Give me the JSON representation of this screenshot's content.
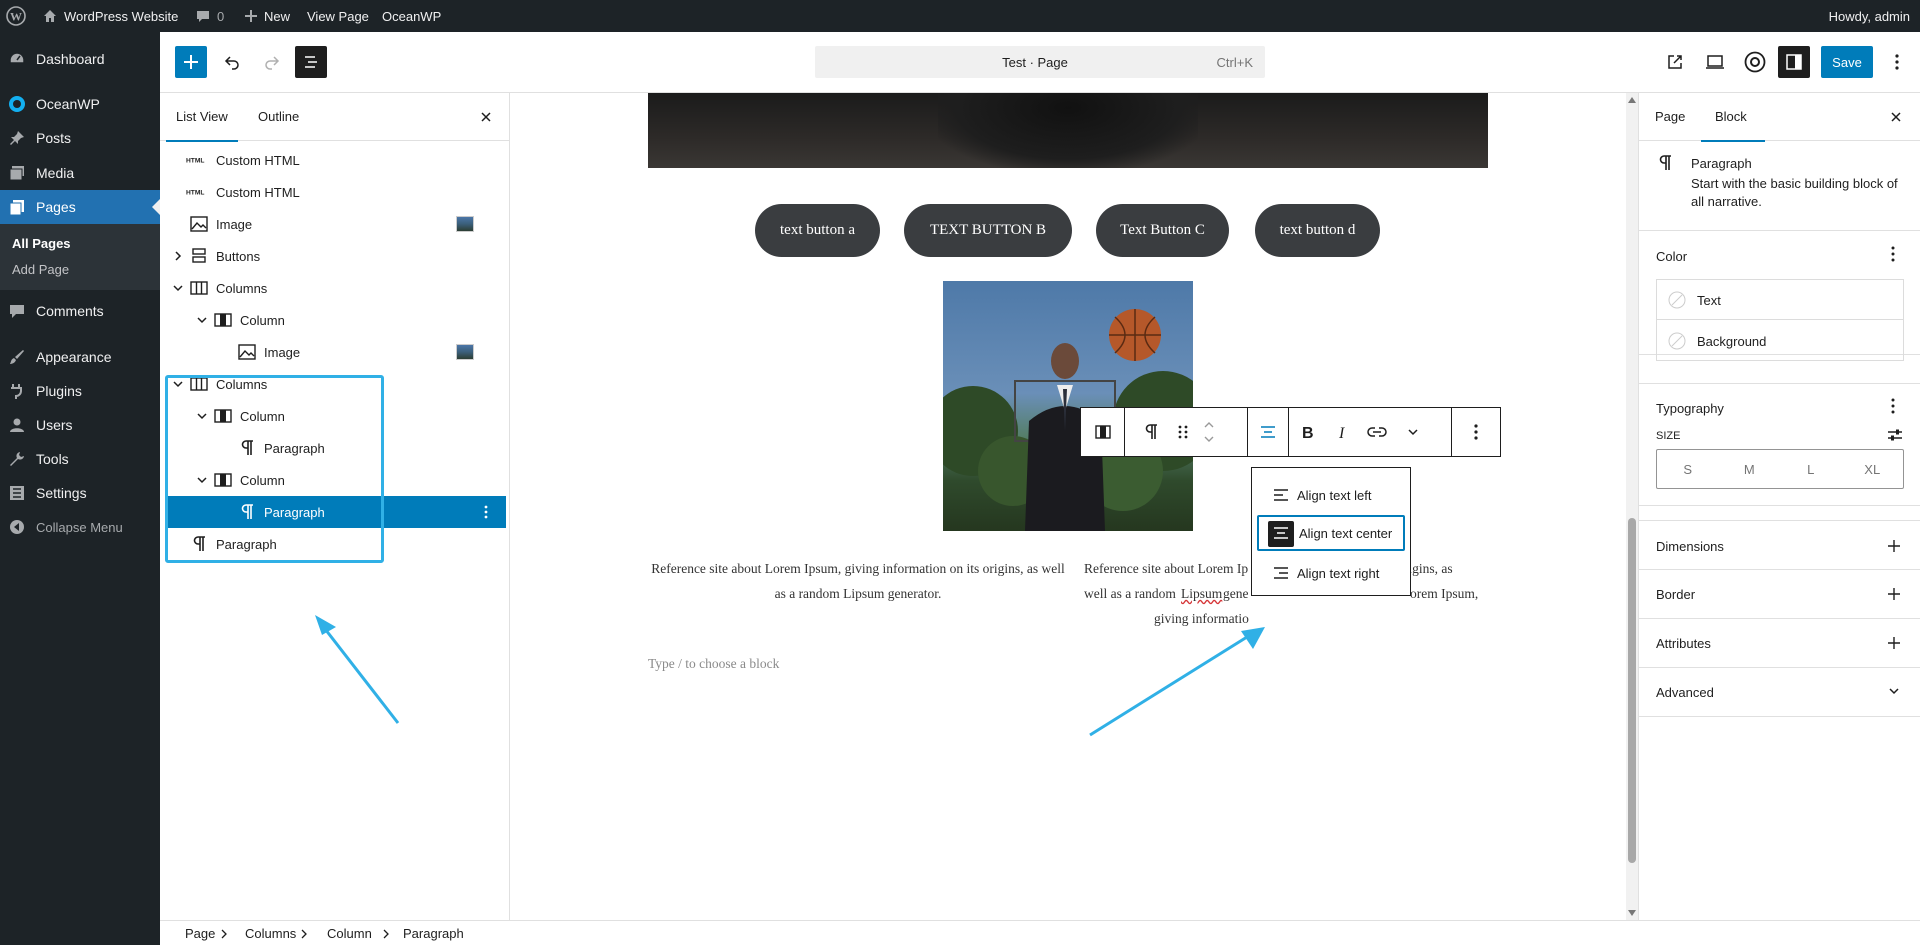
{
  "admin_bar": {
    "site_name": "WordPress Website",
    "comments_count": "0",
    "new_label": "New",
    "view_page_label": "View Page",
    "theme_label": "OceanWP",
    "howdy": "Howdy, admin"
  },
  "admin_menu": {
    "items": [
      {
        "label": "Dashboard",
        "icon": "dashboard-icon"
      },
      {
        "label": "OceanWP",
        "icon": "oceanwp-icon"
      },
      {
        "label": "Posts",
        "icon": "pin-icon"
      },
      {
        "label": "Media",
        "icon": "media-icon"
      },
      {
        "label": "Pages",
        "icon": "pages-icon"
      },
      {
        "label": "Comments",
        "icon": "comments-icon"
      },
      {
        "label": "Appearance",
        "icon": "brush-icon"
      },
      {
        "label": "Plugins",
        "icon": "plugin-icon"
      },
      {
        "label": "Users",
        "icon": "users-icon"
      },
      {
        "label": "Tools",
        "icon": "wrench-icon"
      },
      {
        "label": "Settings",
        "icon": "settings-icon"
      },
      {
        "label": "Collapse Menu",
        "icon": "collapse-icon"
      }
    ],
    "pages_sub": [
      "All Pages",
      "Add Page"
    ]
  },
  "editor_header": {
    "command_title": "Test · Page",
    "command_shortcut": "Ctrl+K",
    "save_label": "Save"
  },
  "list_view": {
    "tabs": [
      "List View",
      "Outline"
    ],
    "items": [
      {
        "label": "Custom HTML",
        "icon": "html-icon"
      },
      {
        "label": "Custom HTML",
        "icon": "html-icon"
      },
      {
        "label": "Image",
        "icon": "image-icon"
      },
      {
        "label": "Buttons",
        "icon": "buttons-icon"
      },
      {
        "label": "Columns",
        "icon": "columns-icon"
      },
      {
        "label": "Column",
        "icon": "column-icon"
      },
      {
        "label": "Image",
        "icon": "image-icon"
      },
      {
        "label": "Columns",
        "icon": "columns-icon"
      },
      {
        "label": "Column",
        "icon": "column-icon"
      },
      {
        "label": "Paragraph",
        "icon": "paragraph-icon"
      },
      {
        "label": "Column",
        "icon": "column-icon"
      },
      {
        "label": "Paragraph",
        "icon": "paragraph-icon"
      },
      {
        "label": "Paragraph",
        "icon": "paragraph-icon"
      }
    ]
  },
  "canvas": {
    "buttons": [
      "text button a",
      "TEXT BUTTON B",
      "Text Button C",
      "text button d"
    ],
    "para_left": "Reference site about Lorem Ipsum, giving information on its origins, as well as a random Lipsum generator.",
    "para_right_1": "Reference site about Lorem Ip",
    "para_right_1b": "its origins, as",
    "para_right_2": "well as a random",
    "para_right_2b": "Lipsum",
    "para_right_2c": "gene",
    "para_right_2d": "orem Ipsum,",
    "para_right_3": "giving informatio",
    "placeholder": "Type / to choose a block",
    "align_menu": [
      "Align text left",
      "Align text center",
      "Align text right"
    ]
  },
  "inspector": {
    "tabs": [
      "Page",
      "Block"
    ],
    "block_title": "Paragraph",
    "block_desc": "Start with the basic building block of all narrative.",
    "color_title": "Color",
    "color_items": [
      "Text",
      "Background"
    ],
    "typography_title": "Typography",
    "size_label": "SIZE",
    "sizes": [
      "S",
      "M",
      "L",
      "XL"
    ],
    "panels": [
      "Dimensions",
      "Border",
      "Attributes",
      "Advanced"
    ]
  },
  "breadcrumb": [
    "Page",
    "Columns",
    "Column",
    "Paragraph"
  ],
  "colors": {
    "accent": "#007cba",
    "admin_dark": "#1d2327",
    "annotation": "#30b0e6"
  }
}
